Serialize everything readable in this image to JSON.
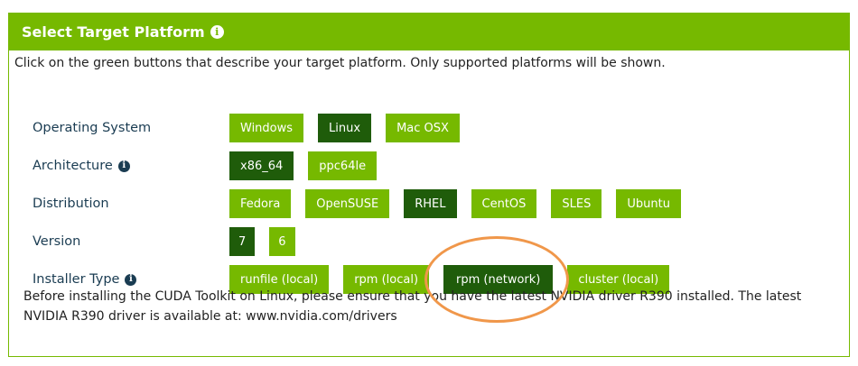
{
  "header": {
    "title": "Select Target Platform",
    "info_icon": "info-icon"
  },
  "intro": "Click on the green buttons that describe your target platform. Only supported platforms will be shown.",
  "rows": [
    {
      "label": "Operating System",
      "has_info": false,
      "options": [
        {
          "label": "Windows",
          "selected": false
        },
        {
          "label": "Linux",
          "selected": true
        },
        {
          "label": "Mac OSX",
          "selected": false
        }
      ]
    },
    {
      "label": "Architecture",
      "has_info": true,
      "options": [
        {
          "label": "x86_64",
          "selected": true
        },
        {
          "label": "ppc64le",
          "selected": false
        }
      ]
    },
    {
      "label": "Distribution",
      "has_info": false,
      "options": [
        {
          "label": "Fedora",
          "selected": false
        },
        {
          "label": "OpenSUSE",
          "selected": false
        },
        {
          "label": "RHEL",
          "selected": true
        },
        {
          "label": "CentOS",
          "selected": false
        },
        {
          "label": "SLES",
          "selected": false
        },
        {
          "label": "Ubuntu",
          "selected": false
        }
      ]
    },
    {
      "label": "Version",
      "has_info": false,
      "options": [
        {
          "label": "7",
          "selected": true
        },
        {
          "label": "6",
          "selected": false
        }
      ]
    },
    {
      "label": "Installer Type",
      "has_info": true,
      "options": [
        {
          "label": "runfile (local)",
          "selected": false
        },
        {
          "label": "rpm (local)",
          "selected": false
        },
        {
          "label": "rpm (network)",
          "selected": true
        },
        {
          "label": "cluster (local)",
          "selected": false
        }
      ]
    }
  ],
  "note": "Before installing the CUDA Toolkit on Linux, please ensure that you have the latest NVIDIA driver R390 installed. The latest NVIDIA R390 driver is available at: www.nvidia.com/drivers",
  "colors": {
    "accent": "#76b900",
    "selected": "#1f5c0a",
    "label_text": "#1a3c52",
    "highlight_ring": "#f0974a"
  }
}
